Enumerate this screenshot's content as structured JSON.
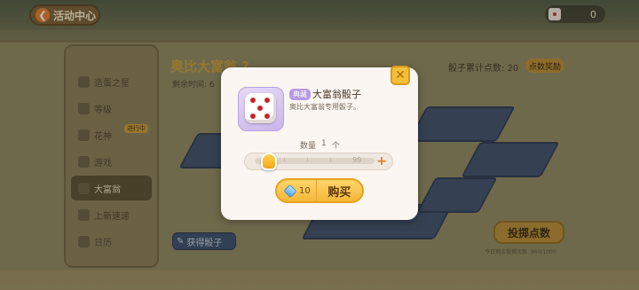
{
  "topbar": {
    "back_label": "活动中心",
    "dice_count": "0"
  },
  "sidebar": {
    "items": [
      {
        "label": "造蛋之星",
        "badge": ""
      },
      {
        "label": "等级",
        "badge": ""
      },
      {
        "label": "花神",
        "badge": "进行中"
      },
      {
        "label": "游戏",
        "badge": ""
      },
      {
        "label": "大富翁",
        "badge": ""
      },
      {
        "label": "上新速递",
        "badge": ""
      },
      {
        "label": "日历",
        "badge": ""
      }
    ]
  },
  "event": {
    "title": "奥比大富翁 ?",
    "remaining": "剩余时间: 6",
    "dice_total_label": "骰子累计点数: 20",
    "dice_reward_label": "点数奖励",
    "get_dice_label": "获得骰子",
    "roll_label": "投掷点数",
    "roll_note": "今日剩余投掷次数: 960/1000"
  },
  "modal": {
    "close_symbol": "✕",
    "tag": "典藏",
    "item_name": "大富翁骰子",
    "item_desc": "奥比大富翁专用骰子。",
    "qty_label": "数量",
    "qty_value": "1",
    "qty_unit": "个",
    "slider_max": "99",
    "slider_fraction": 0.01,
    "plus_symbol": "+",
    "buy_cost": "10",
    "buy_label": "购买"
  },
  "colors": {
    "accent": "#f5b83a",
    "tag": "#b79ae2",
    "pip": "#c8242c"
  }
}
